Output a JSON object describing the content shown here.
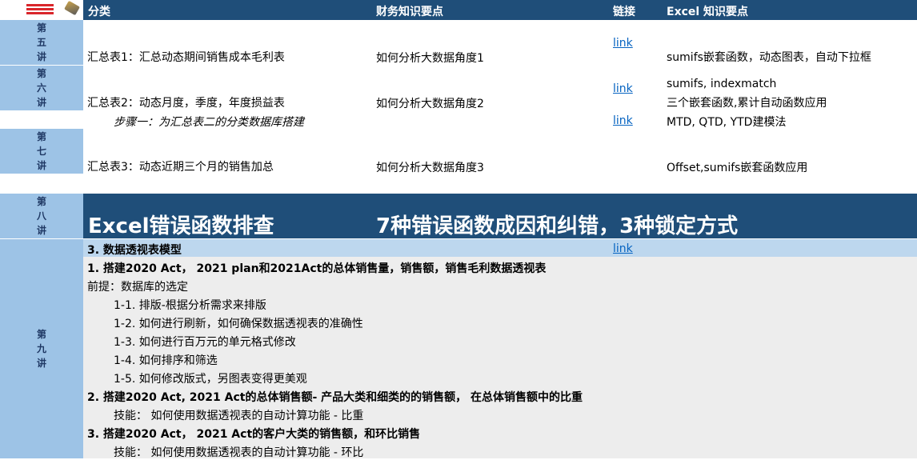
{
  "header": {
    "col_category": "分类",
    "col_finance": "财务知识要点",
    "col_link": "链接",
    "col_excel": "Excel 知识要点"
  },
  "lectures": {
    "l5": [
      "第",
      "五",
      "讲"
    ],
    "l6": [
      "第",
      "六",
      "讲"
    ],
    "l7": [
      "第",
      "七",
      "讲"
    ],
    "l8": [
      "第",
      "八",
      "讲"
    ],
    "l9": [
      "第",
      "九",
      "讲"
    ]
  },
  "rows": {
    "r1": {
      "category": "汇总表1：汇总动态期间销售成本毛利表",
      "finance": "如何分析大数据角度1",
      "link": "link",
      "excel": "sumifs嵌套函数，动态图表，自动下拉框"
    },
    "r2": {
      "category": "汇总表2：动态月度，季度，年度损益表",
      "finance": "如何分析大数据角度2",
      "link": "link",
      "excel_1": "sumifs, indexmatch",
      "excel_2": "三个嵌套函数,累计自动函数应用"
    },
    "r2b": {
      "category": "步骤一：为汇总表二的分类数据库搭建",
      "link": "link",
      "excel": "MTD, QTD, YTD建模法"
    },
    "r3": {
      "category": "汇总表3：动态近期三个月的销售加总",
      "finance": "如何分析大数据角度3",
      "excel": "Offset,sumifs嵌套函数应用"
    }
  },
  "banner": {
    "left": "Excel错误函数排查",
    "right": "7种错误函数成因和纠错，3种锁定方式"
  },
  "pivot": {
    "title": "3. 数据透视表模型",
    "link": "link",
    "items": [
      "1. 搭建2020 Act， 2021 plan和2021Act的总体销售量，销售额，销售毛利数据透视表",
      "前提：数据库的选定",
      "1-1. 排版-根据分析需求来排版",
      "1-2. 如何进行刷新，如何确保数据透视表的准确性",
      "1-3. 如何进行百万元的单元格式修改",
      "1-4. 如何排序和筛选",
      "1-5. 如何修改版式，另图表变得更美观",
      "2. 搭建2020 Act, 2021 Act的总体销售额- 产品大类和细类的的销售额， 在总体销售额中的比重",
      "技能：  如何使用数据透视表的自动计算功能 - 比重",
      "3. 搭建2020 Act，  2021 Act的客户大类的销售额，和环比销售",
      "技能：  如何使用数据透视表的自动计算功能 - 环比"
    ]
  },
  "colors": {
    "header_bg": "#1f4e79",
    "lecture_bg": "#9dc3e6",
    "pivot_bg": "#ededed",
    "pivot_title_bg": "#bdd7ee",
    "link": "#0563c1"
  }
}
